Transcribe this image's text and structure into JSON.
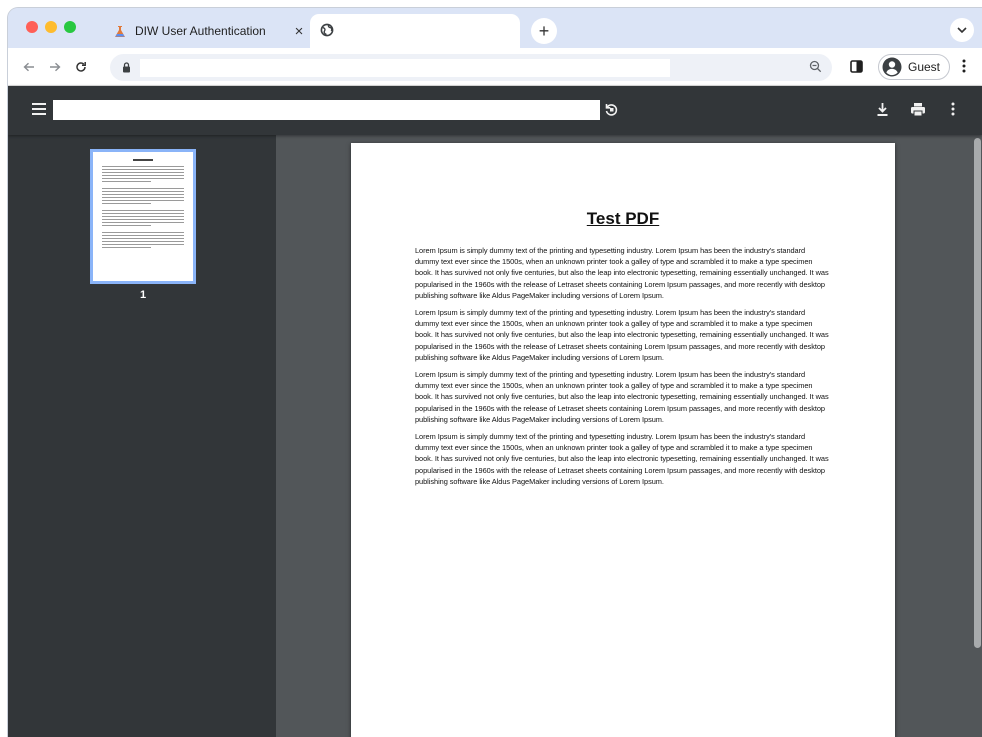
{
  "browser": {
    "tabs": [
      {
        "title": "DIW User Authentication",
        "close": "×"
      },
      {
        "title": ""
      }
    ],
    "new_tab_label": "+",
    "address": {
      "value": ""
    },
    "profile": {
      "label": "Guest"
    }
  },
  "pdf": {
    "title_field": "",
    "thumbnail": {
      "page_number": "1"
    },
    "document": {
      "heading": "Test PDF",
      "paragraphs": [
        "Lorem Ipsum is simply dummy text of the printing and typesetting industry. Lorem Ipsum has been the industry's standard dummy text ever since the 1500s, when an unknown printer took a galley of type and scrambled it to make a type specimen book. It has survived not only five centuries, but also the leap into electronic typesetting, remaining essentially unchanged. It was popularised in the 1960s with the release of Letraset sheets containing Lorem Ipsum passages, and more recently with desktop publishing software like Aldus PageMaker including versions of Lorem Ipsum.",
        "Lorem Ipsum is simply dummy text of the printing and typesetting industry. Lorem Ipsum has been the industry's standard dummy text ever since the 1500s, when an unknown printer took a galley of type and scrambled it to make a type specimen book. It has survived not only five centuries, but also the leap into electronic typesetting, remaining essentially unchanged. It was popularised in the 1960s with the release of Letraset sheets containing Lorem Ipsum passages, and more recently with desktop publishing software like Aldus PageMaker including versions of Lorem Ipsum.",
        "Lorem Ipsum is simply dummy text of the printing and typesetting industry. Lorem Ipsum has been the industry's standard dummy text ever since the 1500s, when an unknown printer took a galley of type and scrambled it to make a type specimen book. It has survived not only five centuries, but also the leap into electronic typesetting, remaining essentially unchanged. It was popularised in the 1960s with the release of Letraset sheets containing Lorem Ipsum passages, and more recently with desktop publishing software like Aldus PageMaker including versions of Lorem Ipsum.",
        "Lorem Ipsum is simply dummy text of the printing and typesetting industry. Lorem Ipsum has been the industry's standard dummy text ever since the 1500s, when an unknown printer took a galley of type and scrambled it to make a type specimen book. It has survived not only five centuries, but also the leap into electronic typesetting, remaining essentially unchanged. It was popularised in the 1960s with the release of Letraset sheets containing Lorem Ipsum passages, and more recently with desktop publishing software like Aldus PageMaker including versions of Lorem Ipsum."
      ]
    }
  },
  "icons": {
    "tab1_favicon": "flask-icon",
    "tab2_favicon": "globe-icon",
    "back": "back-arrow-icon",
    "forward": "forward-arrow-icon",
    "reload": "reload-icon",
    "lock": "lock-icon",
    "zoom": "zoom-icon",
    "side_panel": "side-panel-icon",
    "profile": "person-icon",
    "menu": "kebab-menu-icon",
    "pdf_menu": "hamburger-icon",
    "rotate": "rotate-icon",
    "download": "download-icon",
    "print": "print-icon"
  },
  "colors": {
    "tabstrip": "#dbe4f6",
    "pdf_toolbar": "#323639",
    "viewer_bg": "#525659",
    "thumbnail_border": "#8ab4f8"
  }
}
